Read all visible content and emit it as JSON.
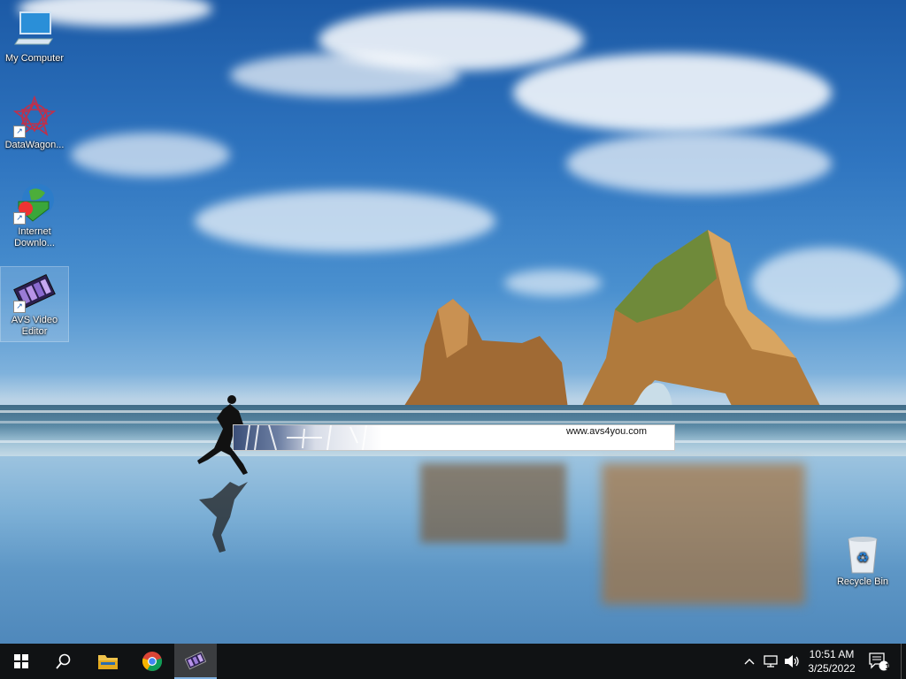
{
  "desktop": {
    "icons": [
      {
        "label": "My Computer"
      },
      {
        "label": "DataWagon..."
      },
      {
        "label": "Internet Downlo..."
      },
      {
        "label": "AVS Video Editor"
      },
      {
        "label": "Recycle Bin"
      }
    ]
  },
  "splash": {
    "url": "www.avs4you.com"
  },
  "taskbar": {
    "start": "start-icon",
    "search": "search-icon",
    "pinned": [
      {
        "name": "file-explorer-icon"
      },
      {
        "name": "chrome-icon"
      },
      {
        "name": "avs-video-editor-icon",
        "active": true
      }
    ],
    "tray": {
      "chevron": "chevron-up-icon",
      "network": "network-icon",
      "volume": "volume-icon",
      "time": "10:51 AM",
      "date": "3/25/2022",
      "notifications_count": "1"
    }
  },
  "colors": {
    "taskbar": "#101214",
    "active_indicator": "#7fb0e0"
  }
}
